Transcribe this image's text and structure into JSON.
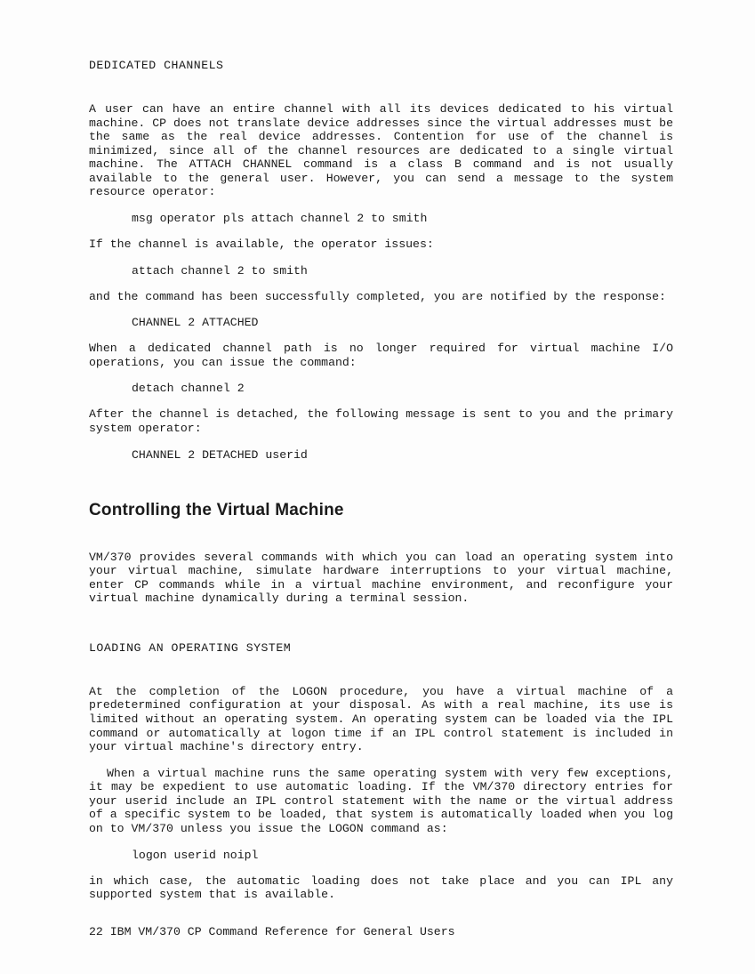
{
  "sec1_title": "DEDICATED CHANNELS",
  "p1": "A user can have an entire channel with all its devices dedicated to his virtual machine. CP does not translate device addresses since the virtual addresses must be the same as the real device addresses. Contention for use of the channel is minimized, since all of the channel resources are dedicated to a single virtual machine. The ATTACH CHANNEL command is a class B command and is not usually available to the general user. However, you can send a message to the system resource operator:",
  "cmd1": "msg operator pls attach channel 2 to smith",
  "p2": "If the channel is available, the operator issues:",
  "cmd2": "attach channel 2 to smith",
  "p3": "and the command has been successfully completed, you are notified by the response:",
  "cmd3": "CHANNEL 2 ATTACHED",
  "p4": "When a dedicated channel path is no longer required for virtual machine I/O operations, you can issue the command:",
  "cmd4": "detach channel 2",
  "p5": "After the channel is detached, the following message is sent to you and the primary system operator:",
  "cmd5": "CHANNEL 2 DETACHED userid",
  "heading2": "Controlling the Virtual Machine",
  "p6": "VM/370 provides several commands with which you can load an operating system into your virtual machine, simulate hardware interruptions to your virtual machine, enter CP commands while in a virtual machine environment, and reconfigure your virtual machine dynamically during a terminal session.",
  "sub1": "LOADING AN OPERATING SYSTEM",
  "p7": "At the completion of the LOGON procedure, you have a virtual machine of a predetermined configuration at your disposal. As with a real machine, its use is limited without an operating system. An operating system can be loaded via the IPL command or automatically at logon time if an IPL control statement is included in your virtual machine's directory entry.",
  "p8": "When a virtual machine runs the same operating system with very few exceptions, it may be expedient to use automatic loading. If the VM/370 directory entries for your userid include an IPL control statement with the name or the virtual address of a specific system to be loaded, that system is automatically loaded when you log on to VM/370 unless you issue the LOGON command as:",
  "cmd6": "logon userid noipl",
  "p9": "in which case, the automatic loading does not take place and you can IPL any supported system that is available.",
  "footer": "22  IBM VM/370 CP Command Reference for General Users"
}
